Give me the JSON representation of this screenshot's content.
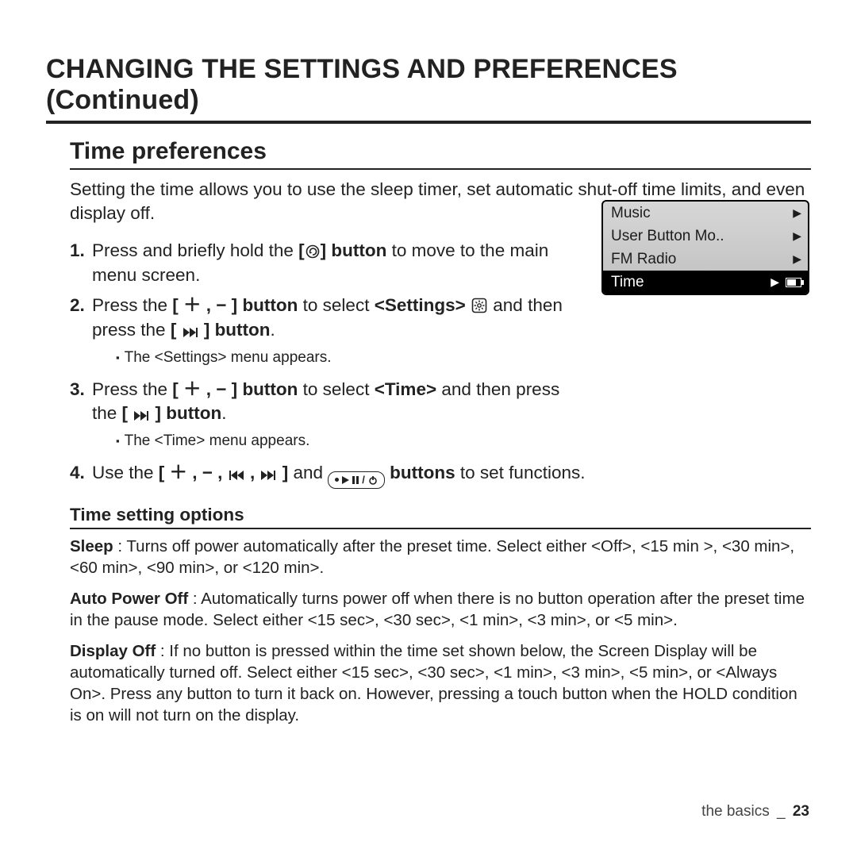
{
  "title": "CHANGING THE SETTINGS AND PREFERENCES (Continued)",
  "section": "Time preferences",
  "intro": "Setting the time allows you to use the sleep timer, set automatic shut-off time limits, and even display off.",
  "steps": {
    "s1_a": "Press and briefly hold the ",
    "s1_b": " button",
    "s1_c": " to move to the main menu screen.",
    "s2_a": "Press the ",
    "s2_b": " button",
    "s2_c": " to select ",
    "s2_d": "<Settings>",
    "s2_e": " and then press the ",
    "s2_f": " button",
    "s2_g": ".",
    "s2_sub": "The <Settings> menu appears.",
    "s3_a": "Press the ",
    "s3_b": " button",
    "s3_c": " to select ",
    "s3_d": "<Time>",
    "s3_e": " and then press the ",
    "s3_f": " button",
    "s3_g": ".",
    "s3_sub": "The <Time> menu appears.",
    "s4_a": "Use the ",
    "s4_b": " and ",
    "s4_c": " buttons",
    "s4_d": " to set functions.",
    "pm": "[ ＋ , − ]",
    "nav": "[ ＋ , − , ",
    "nav2": " , ",
    "nav3": " ]"
  },
  "h3": "Time setting options",
  "options": {
    "sleep_t": "Sleep",
    "sleep_b": " : Turns off power automatically after the preset time. Select either <Off>, <15 min >, <30 min>, <60 min>, <90 min>, or <120 min>.",
    "apo_t": "Auto Power Off",
    "apo_b": " : Automatically turns power off when there is no button operation after the preset time in the pause mode. Select either <15 sec>, <30 sec>, <1 min>, <3 min>, or <5 min>.",
    "do_t": "Display Off",
    "do_b": " : If no button is pressed within the time set shown below, the Screen Display will be automatically turned off. Select either <15 sec>, <30 sec>, <1 min>, <3 min>, <5 min>, or <Always On>. Press any button to turn it back on. However, pressing a touch button when the HOLD condition is on will not turn on the display."
  },
  "device": {
    "items": [
      "Music",
      "User Button Mo..",
      "FM Radio",
      "Time"
    ]
  },
  "footer": {
    "section": "the basics",
    "sep": "_",
    "page": "23"
  }
}
